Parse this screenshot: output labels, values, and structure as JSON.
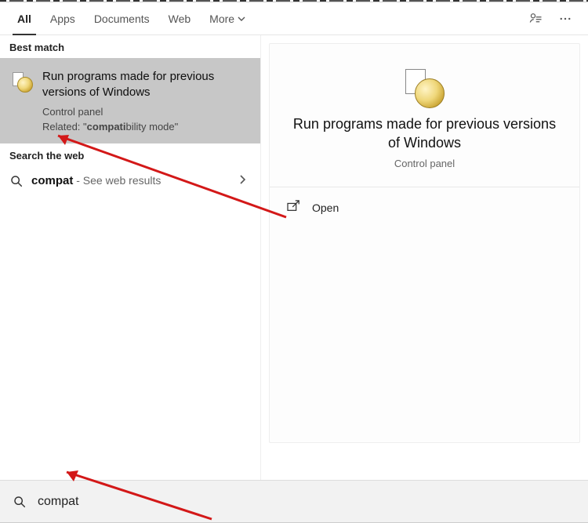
{
  "tabs": {
    "all": "All",
    "apps": "Apps",
    "documents": "Documents",
    "web": "Web",
    "more": "More"
  },
  "sections": {
    "best_match": "Best match",
    "search_web": "Search the web"
  },
  "best_match": {
    "title": "Run programs made for previous versions of Windows",
    "subtitle": "Control panel",
    "related_prefix": "Related: \"",
    "related_bold": "compati",
    "related_rest": "bility mode\""
  },
  "web": {
    "query": "compat",
    "suffix": " - See web results"
  },
  "preview": {
    "title": "Run programs made for previous versions of Windows",
    "subtitle": "Control panel",
    "actions": {
      "open": "Open"
    }
  },
  "search": {
    "value": "compat"
  },
  "icons": {
    "feedback": "feedback-icon",
    "more": "more-icon",
    "control_panel": "control-panel-icon",
    "search": "search-icon",
    "chevron_down": "chevron-down-icon",
    "chevron_right": "chevron-right-icon",
    "open": "open-icon"
  }
}
